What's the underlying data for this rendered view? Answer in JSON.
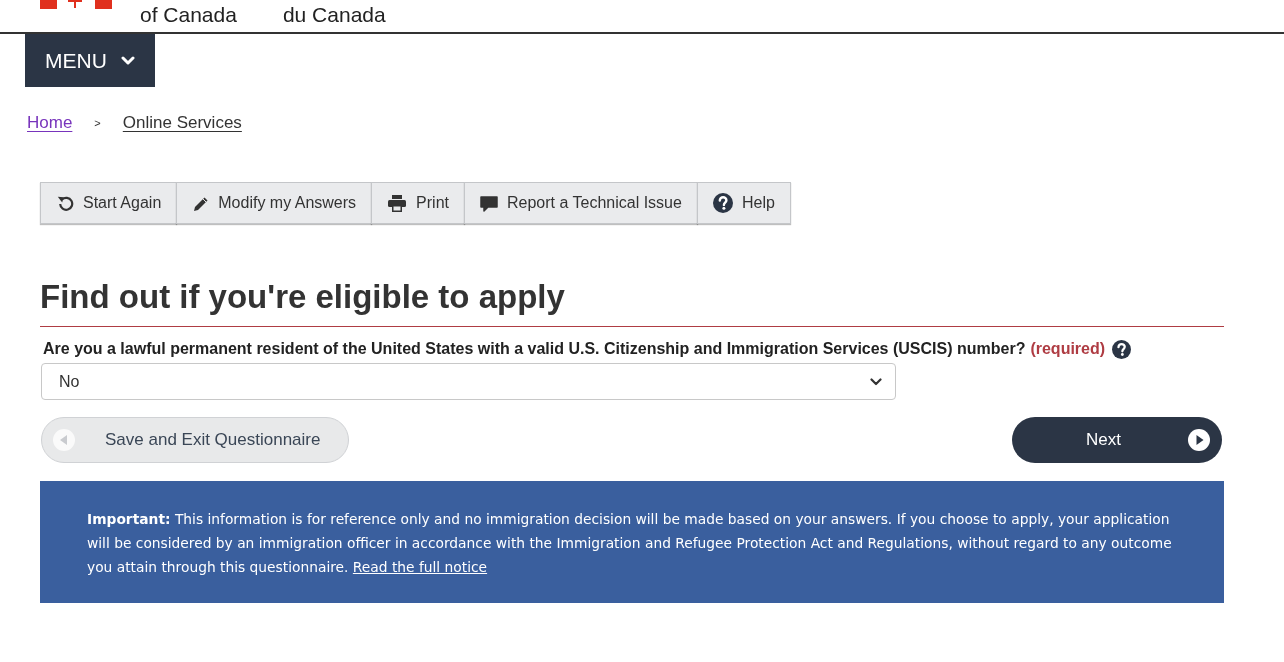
{
  "signature": [
    "of Canada",
    "du Canada"
  ],
  "menu_button": {
    "label": "MENU"
  },
  "breadcrumb": {
    "items": [
      {
        "label": "Home",
        "visited": true
      },
      {
        "label": "Online Services",
        "visited": false
      }
    ],
    "separator": ">"
  },
  "toolbar": [
    {
      "label": "Start Again"
    },
    {
      "label": "Modify my Answers"
    },
    {
      "label": "Print"
    },
    {
      "label": "Report a Technical Issue"
    },
    {
      "label": "Help"
    }
  ],
  "heading": "Find out if you're eligible to apply",
  "question": {
    "label": "Are you a lawful permanent resident of the United States with a valid U.S. Citizenship and Immigration Services (USCIS) number?",
    "required": "(required)",
    "select": {
      "value": "No"
    }
  },
  "actions": {
    "save_exit": "Save and Exit Questionnaire",
    "next": "Next"
  },
  "notice": {
    "text": "**Important:** This information is for reference only and no immigration decision will be made based on your answers. If you choose to apply, your application will be considered by an immigration officer in accordance with the Immigration and Refugee Protection Act and Regulations, without regard to any outcome you attain through this questionnaire.",
    "link": "Read the full notice"
  }
}
